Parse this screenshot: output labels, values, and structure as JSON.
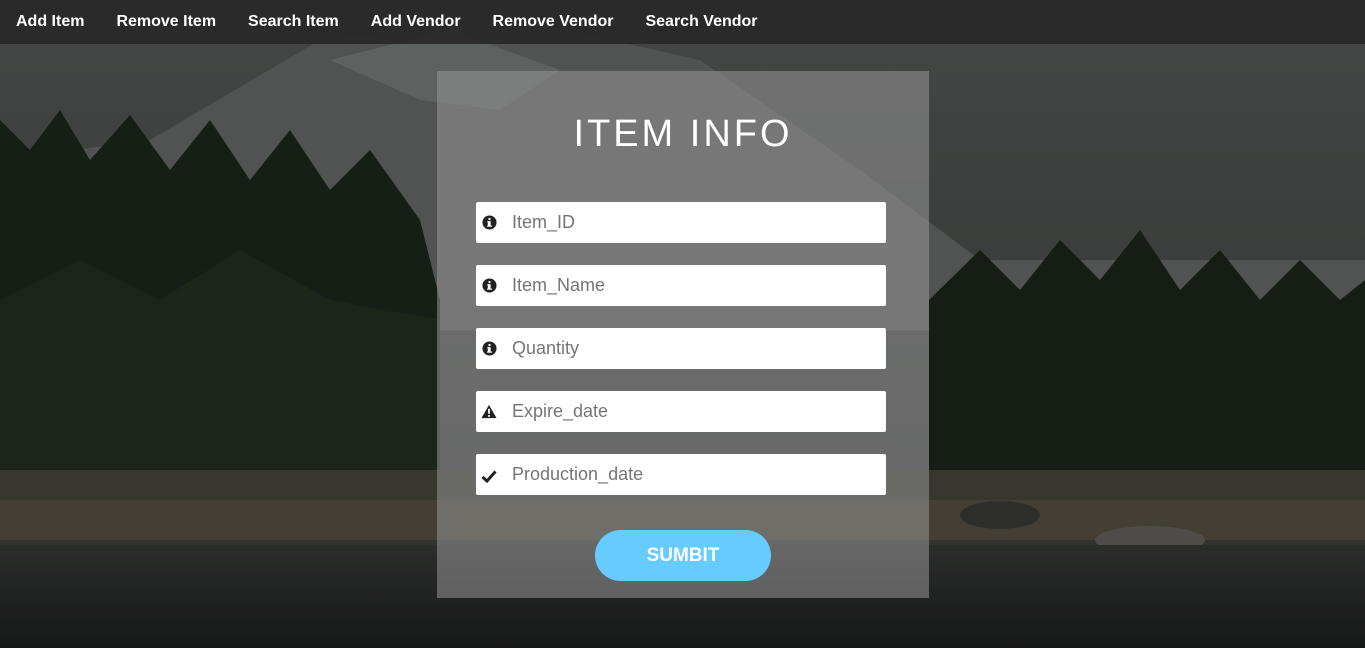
{
  "nav": {
    "items": [
      {
        "label": "Add Item"
      },
      {
        "label": "Remove Item"
      },
      {
        "label": "Search Item"
      },
      {
        "label": "Add Vendor"
      },
      {
        "label": "Remove Vendor"
      },
      {
        "label": "Search Vendor"
      }
    ]
  },
  "form": {
    "title": "ITEM INFO",
    "fields": [
      {
        "placeholder": "Item_ID",
        "icon": "info-circle-icon"
      },
      {
        "placeholder": "Item_Name",
        "icon": "info-circle-icon"
      },
      {
        "placeholder": "Quantity",
        "icon": "info-circle-icon"
      },
      {
        "placeholder": "Expire_date",
        "icon": "warning-triangle-icon"
      },
      {
        "placeholder": "Production_date",
        "icon": "checkmark-icon"
      }
    ],
    "submit_label": "SUMBIT"
  },
  "colors": {
    "navbar": "#282828",
    "submit_button": "#66ccff",
    "panel_overlay": "#969696"
  }
}
